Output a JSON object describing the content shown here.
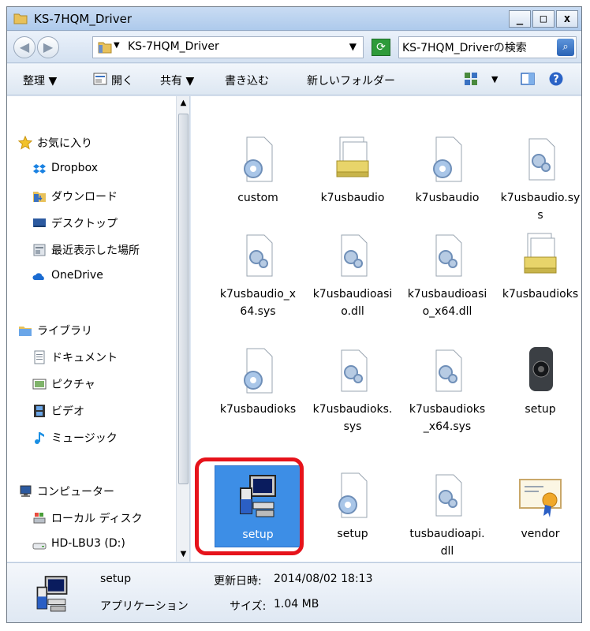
{
  "window": {
    "title": "KS-7HQM_Driver",
    "controls": [
      "_",
      "□",
      "x"
    ]
  },
  "address": {
    "path": "KS-7HQM_Driver",
    "search_placeholder": "KS-7HQM_Driverの検索"
  },
  "toolbar": {
    "organize": "整理 ▼",
    "open": "開く",
    "share": "共有 ▼",
    "burn": "書き込む",
    "new_folder": "新しいフォルダー",
    "view_dropdown": "▼"
  },
  "sidebar": {
    "items": [
      {
        "label": "お気に入り",
        "icon": "star-icon"
      },
      {
        "label": "Dropbox",
        "icon": "dropbox-icon"
      },
      {
        "label": "ダウンロード",
        "icon": "downloads-icon"
      },
      {
        "label": "デスクトップ",
        "icon": "desktop-icon"
      },
      {
        "label": "最近表示した場所",
        "icon": "recent-places-icon"
      },
      {
        "label": "OneDrive",
        "icon": "onedrive-icon"
      },
      {
        "label": "ライブラリ",
        "icon": "libraries-icon"
      },
      {
        "label": "ドキュメント",
        "icon": "documents-icon"
      },
      {
        "label": "ピクチャ",
        "icon": "pictures-icon"
      },
      {
        "label": "ビデオ",
        "icon": "videos-icon"
      },
      {
        "label": "ミュージック",
        "icon": "music-icon"
      },
      {
        "label": "コンピューター",
        "icon": "computer-icon"
      },
      {
        "label": "ローカル ディスク",
        "icon": "local-disk-icon"
      },
      {
        "label": "HD-LBU3 (D:)",
        "icon": "external-drive-icon"
      }
    ]
  },
  "files": [
    {
      "name": "custom",
      "icon": "config-file-icon"
    },
    {
      "name": "k7usbaudio",
      "icon": "setup-info-icon"
    },
    {
      "name": "k7usbaudio",
      "icon": "config-file-icon"
    },
    {
      "name": "k7usbaudio.sys",
      "icon": "system-file-icon"
    },
    {
      "name": "k7usbaudio_x64.sys",
      "icon": "system-file-icon"
    },
    {
      "name": "k7usbaudioasio.dll",
      "icon": "system-file-icon"
    },
    {
      "name": "k7usbaudioasio_x64.dll",
      "icon": "system-file-icon"
    },
    {
      "name": "k7usbaudioks",
      "icon": "setup-info-icon"
    },
    {
      "name": "k7usbaudioks",
      "icon": "config-file-icon"
    },
    {
      "name": "k7usbaudioks.sys",
      "icon": "system-file-icon"
    },
    {
      "name": "k7usbaudioks_x64.sys",
      "icon": "system-file-icon"
    },
    {
      "name": "setup",
      "icon": "speaker-image-icon"
    },
    {
      "name": "setup",
      "icon": "installer-icon"
    },
    {
      "name": "setup",
      "icon": "config-file-icon"
    },
    {
      "name": "tusbaudioapi.dll",
      "icon": "system-file-icon"
    },
    {
      "name": "vendor",
      "icon": "certificate-icon"
    }
  ],
  "status": {
    "name": "setup",
    "type": "アプリケーション",
    "modified_label": "更新日時:",
    "modified_value": "2014/08/02 18:13",
    "size_label": "サイズ:",
    "size_value": "1.04 MB"
  },
  "colors": {
    "selection": "#3d8ee6",
    "highlight_ring": "#e6131b"
  }
}
